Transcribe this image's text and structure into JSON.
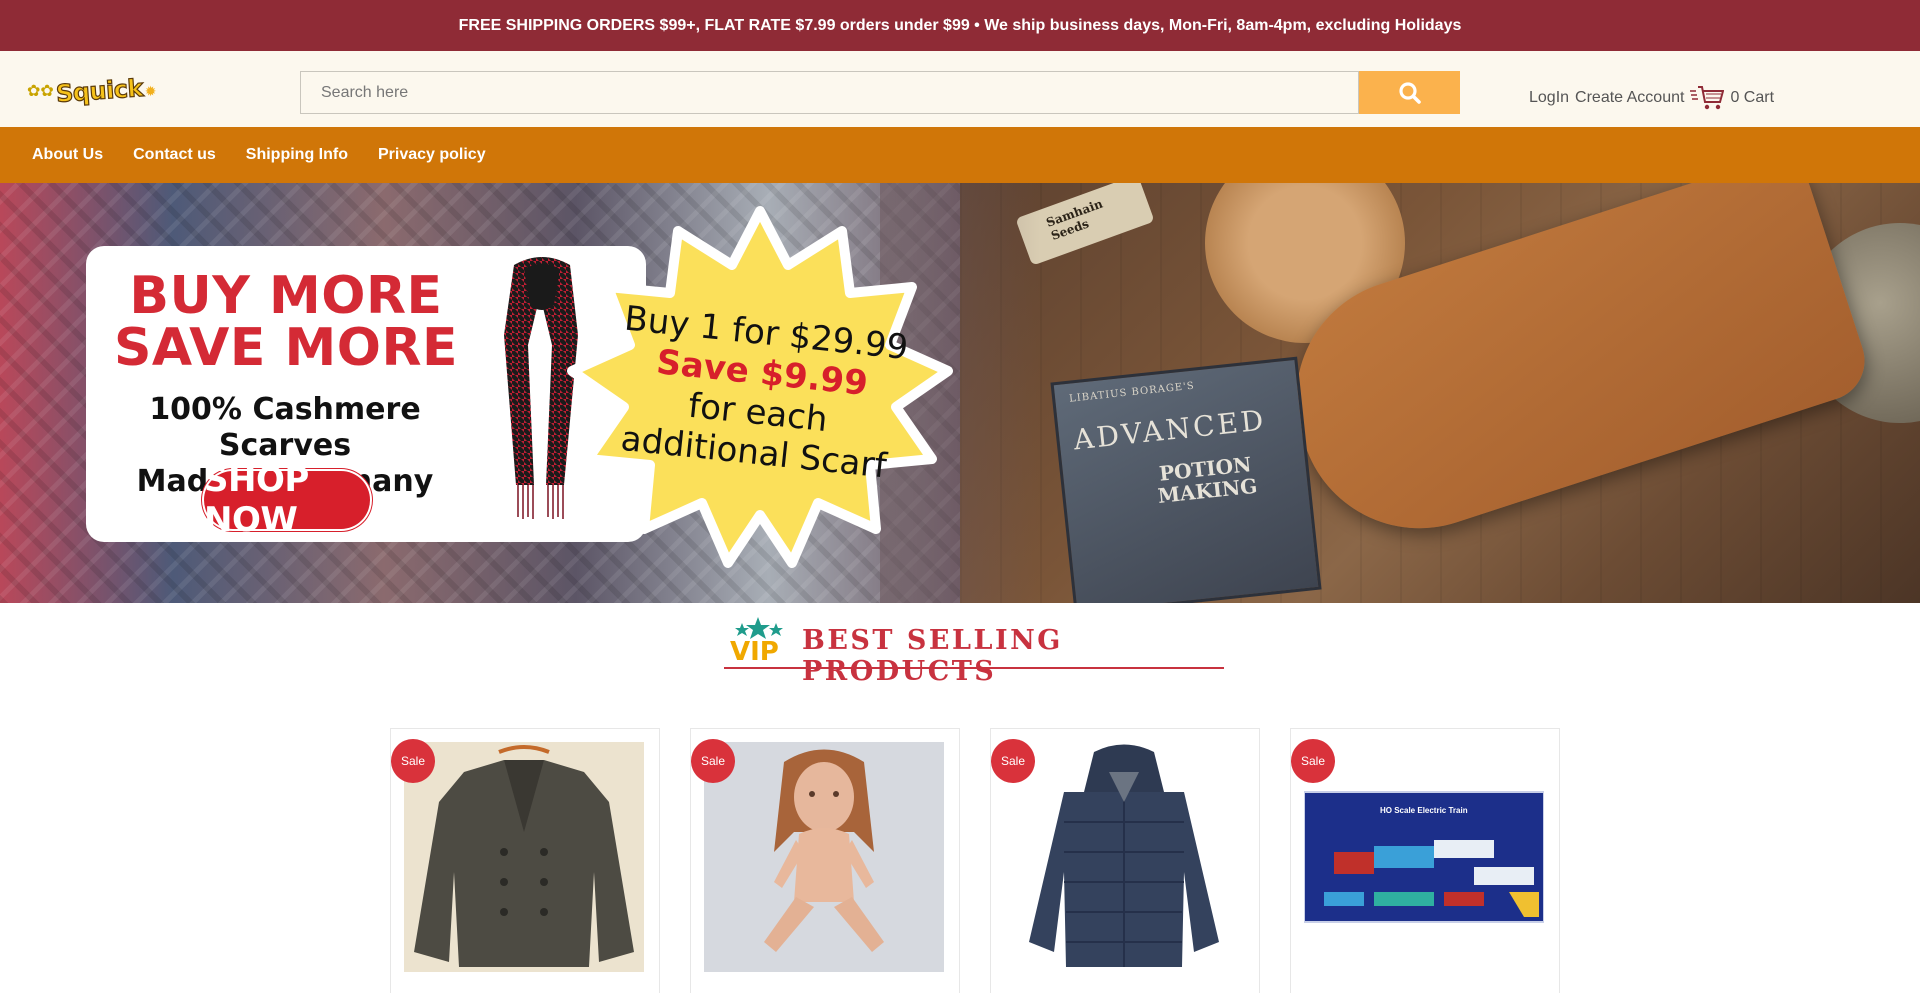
{
  "promo_bar": {
    "text": "FREE SHIPPING ORDERS $99+, FLAT RATE $7.99 orders under $99 • We ship business days, Mon-Fri, 8am-4pm, excluding Holidays"
  },
  "header": {
    "logo_text": "Squick",
    "search": {
      "placeholder": "Search here",
      "value": ""
    },
    "login_label": "LogIn",
    "create_account_label": "Create Account",
    "cart_label": "0 Cart"
  },
  "nav": {
    "items": [
      {
        "label": "About Us"
      },
      {
        "label": "Contact us"
      },
      {
        "label": "Shipping Info"
      },
      {
        "label": "Privacy policy"
      }
    ]
  },
  "hero": {
    "headline_line1": "BUY MORE",
    "headline_line2": "SAVE MORE",
    "subline_line1": "100% Cashmere Scarves",
    "subline_line2": "Made in Germany",
    "cta_label": "SHOP NOW",
    "burst_line1": "Buy 1 for $29.99",
    "burst_line2": "Save $9.99",
    "burst_line3": "for each",
    "burst_line4": "additional Scarf",
    "book_author": "LIBATIUS BORAGE'S",
    "book_title1": "ADVANCED",
    "book_title2a": "POTION",
    "book_title2b": "MAKING",
    "vial_line1": "Samhain",
    "vial_line2": "Seeds"
  },
  "best_selling": {
    "vip_text": "VIP",
    "heading": "BEST SELLING PRODUCTS",
    "products": [
      {
        "badge": "Sale",
        "image": "wool-peacoat"
      },
      {
        "badge": "Sale",
        "image": "doll"
      },
      {
        "badge": "Sale",
        "image": "puffer-jacket"
      },
      {
        "badge": "Sale",
        "image": "electric-train-set",
        "image_text": "HO Scale Electric Train"
      }
    ]
  },
  "colors": {
    "promo_bar": "#8f2b36",
    "header_bg": "#fcf8ee",
    "search_button": "#fbb24d",
    "nav_bar": "#d07608",
    "heading_red": "#c8323f",
    "sale_badge": "#d9323b"
  }
}
